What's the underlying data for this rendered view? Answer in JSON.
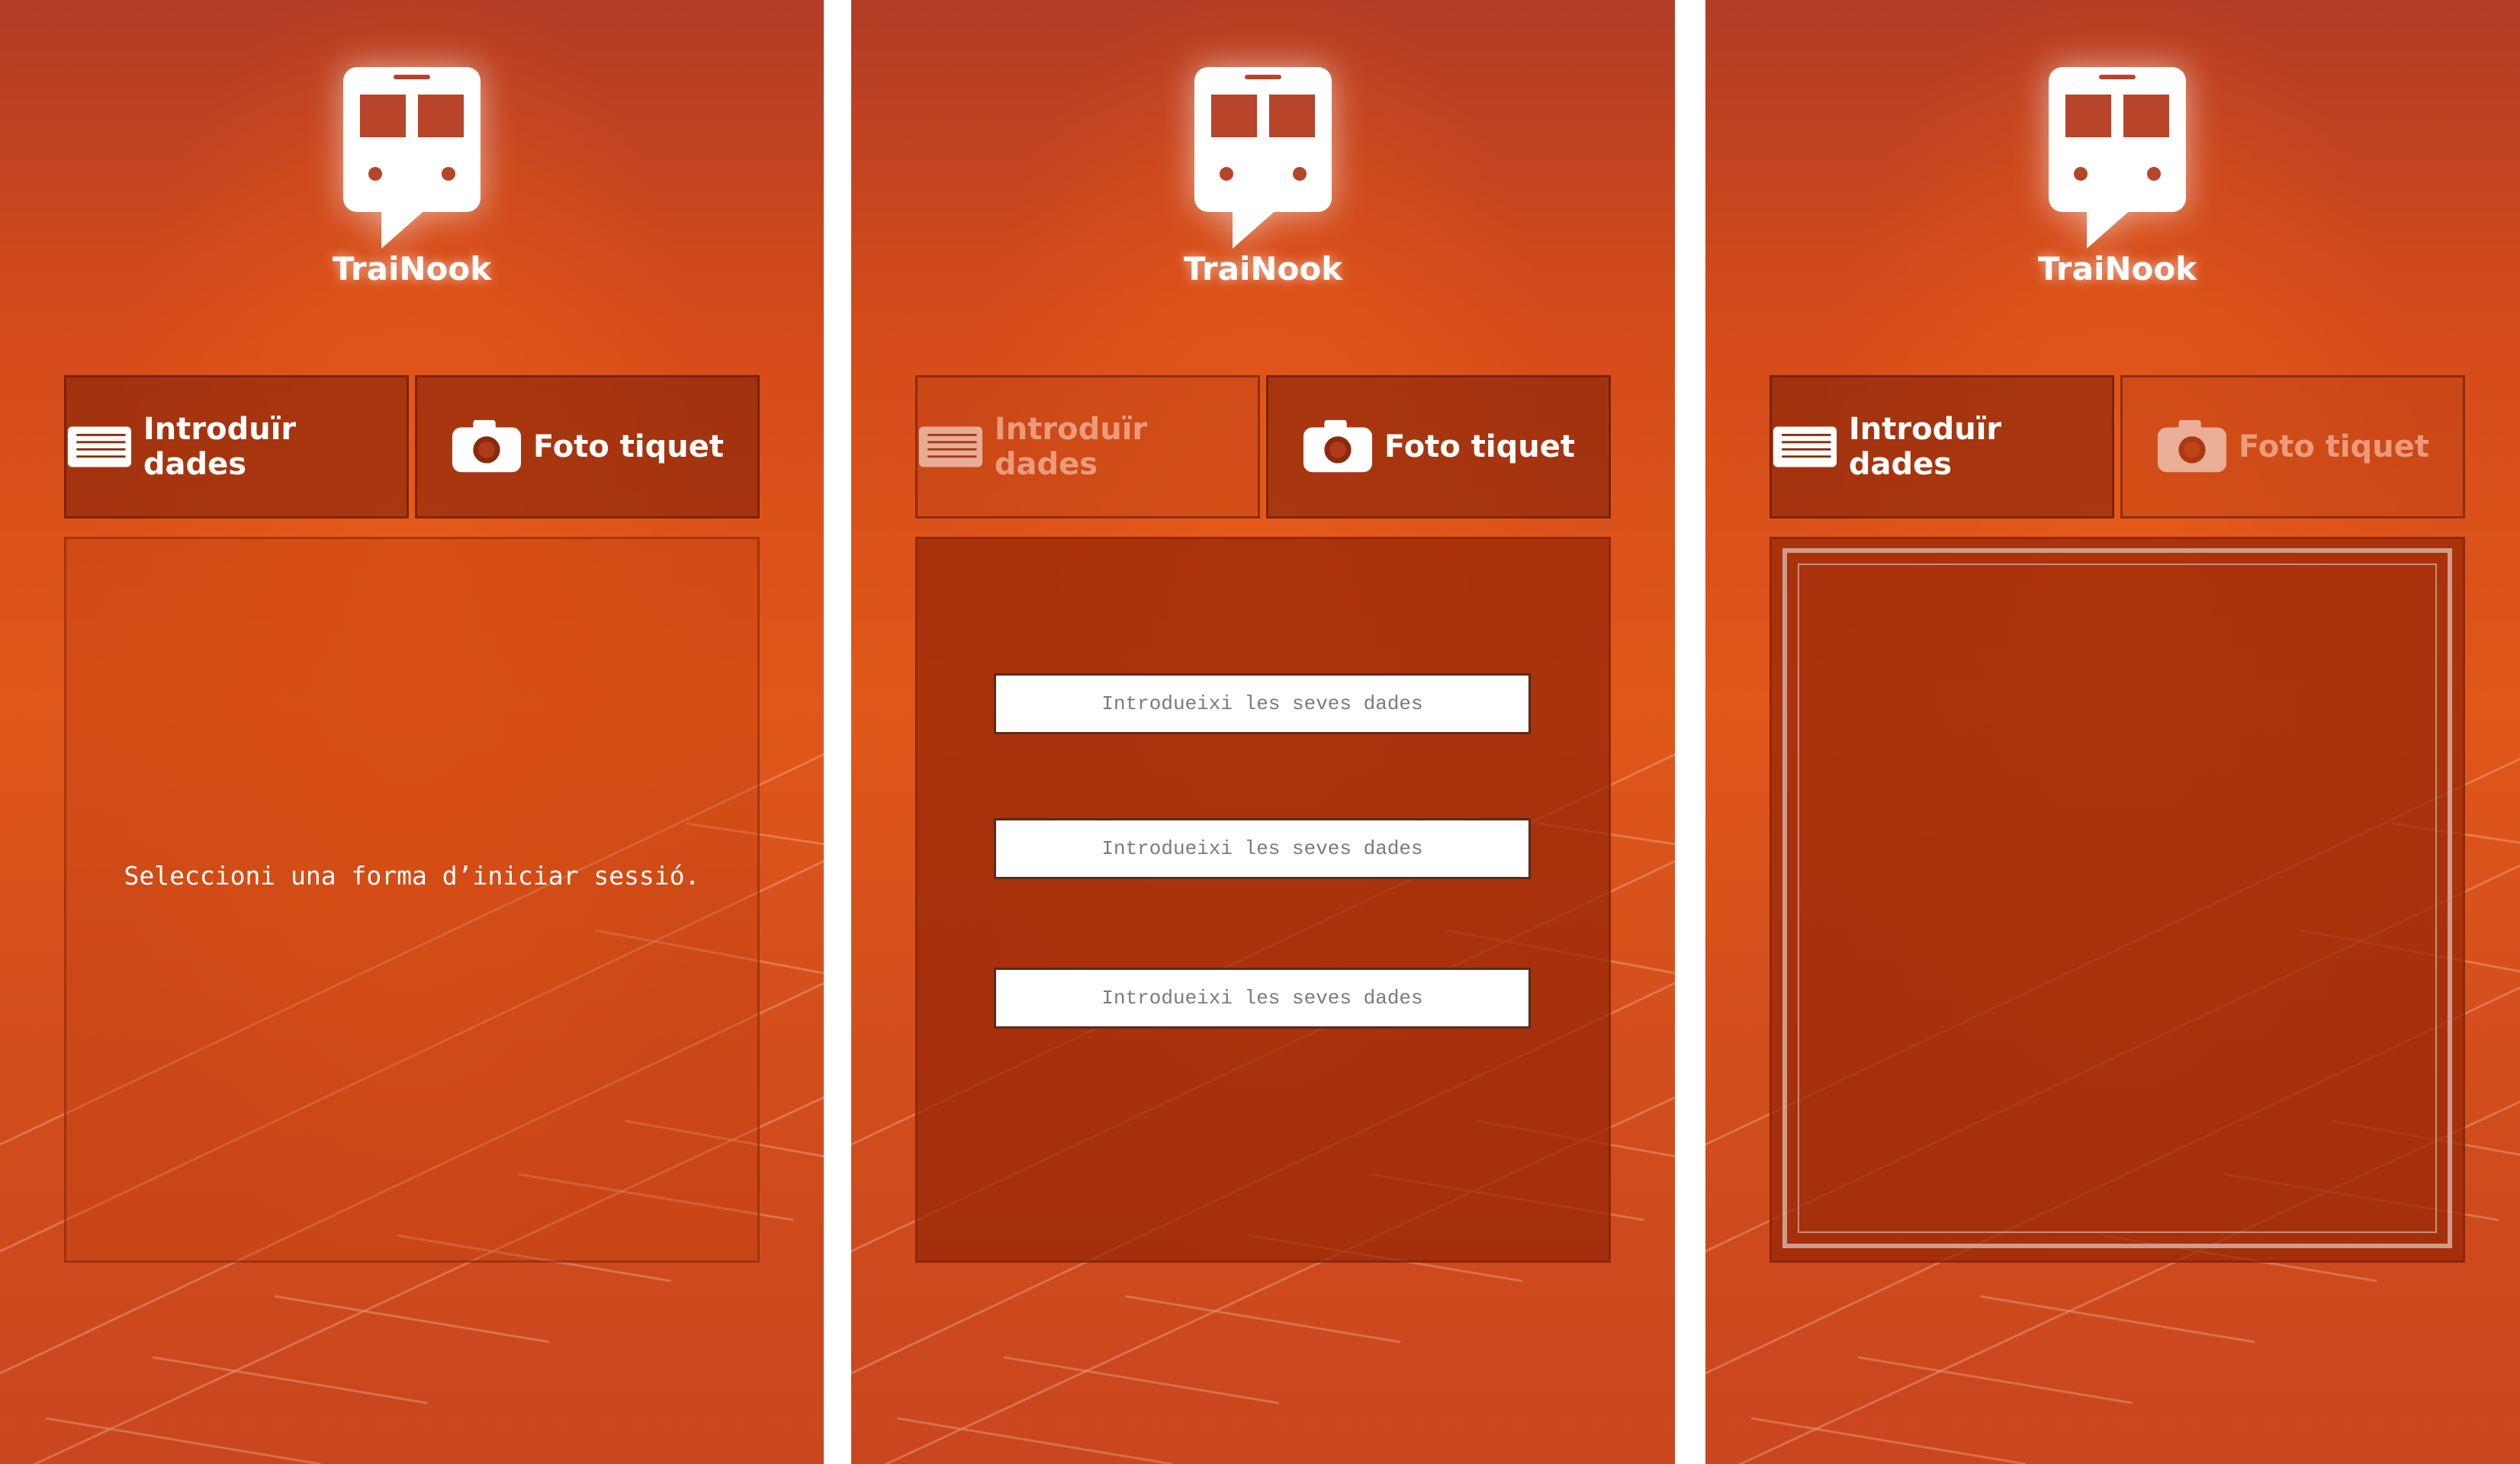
{
  "app_name": "TraiNook",
  "tabs": {
    "enter_data_label": "Introduïr dades",
    "photo_ticket_label": "Foto tiquet"
  },
  "screen_1": {
    "message": "Seleccioni una forma d’iniciar sessió."
  },
  "screen_2": {
    "fields": [
      {
        "placeholder": "Introdueixi les seves dades"
      },
      {
        "placeholder": "Introdueixi les seves dades"
      },
      {
        "placeholder": "Introdueixi les seves dades"
      }
    ]
  },
  "icons": {
    "logo": "train-speech-bubble-icon",
    "enter_data": "list-icon",
    "photo_ticket": "camera-icon"
  },
  "colors": {
    "background": "#d44b1a",
    "tab_background": "#8a2a0c",
    "field_background": "#ffffff",
    "text": "#ffffff"
  }
}
